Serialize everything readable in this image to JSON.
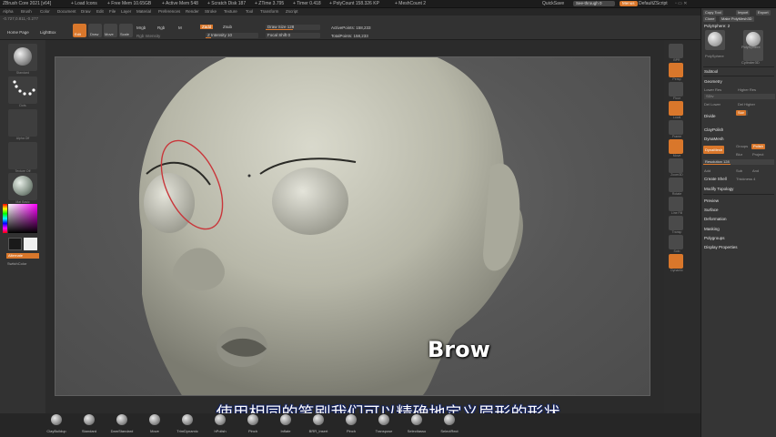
{
  "titlebar": {
    "app": "ZBrush Core 2021 [v64]",
    "load": "+ Load Icons",
    "free_mem": "+ Free Mem 10.65GB",
    "active_mem": "+ Active Mem 548",
    "scratch": "+ Scratch Disk 187",
    "ztime": "+ ZTime 3.795",
    "timer": "+ Timer 0.418",
    "polycount": "+ PolyCount 158.326 KP",
    "meshcount": "+ MeshCount 2",
    "quicksave": "QuickSave",
    "see_through": "See-through 0",
    "menus": "Menus",
    "default_script": "DefaultZScript"
  },
  "menubar": [
    "Alpha",
    "Brush",
    "Color",
    "Document",
    "Draw",
    "Edit",
    "File",
    "Layer",
    "Material",
    "Preferences",
    "Render",
    "Stroke",
    "Texture",
    "Tool",
    "Transform",
    "Zscript"
  ],
  "coords": "-0.727,0.811,-0.277",
  "toolbar": {
    "home_page": "Home Page",
    "lightbox": "LightBox",
    "edit": "Edit",
    "draw": "Draw",
    "move": "Move",
    "scale": "Scale",
    "rotate": "Rotate",
    "mrgb": "Mrgb",
    "rgb": "Rgb",
    "m": "M",
    "rgb_intensity": "Rgb Intensity",
    "zadd": "Zadd",
    "zsub": "Zsub",
    "z_intensity": "Z Intensity 10",
    "draw_size": "Draw Size 128",
    "focal_shift": "Focal Shift 0",
    "active_points": "ActivePoints: 158,233",
    "total_points": "TotalPoints: 158,233"
  },
  "progress": {
    "z_intensity": 0.1,
    "draw_size": 0.5
  },
  "left_shelf": [
    {
      "label": "Standard",
      "kind": "sphere"
    },
    {
      "label": "Dots",
      "kind": "dots"
    },
    {
      "label": "Alpha Off",
      "kind": "empty"
    },
    {
      "label": "Texture Off",
      "kind": "empty"
    },
    {
      "label": "Mat Basic",
      "kind": "matcap"
    }
  ],
  "color": {
    "alternate": "Alternate",
    "main": "#1a1a1a",
    "secondary": "#f0f0f0"
  },
  "half_label": "SwitchColor",
  "canvas_caption": "Brow",
  "subtitle": "使用相同的笔刷我们可以精确地定义眉形的形状",
  "bottom_brushes": [
    "ClayBuildup",
    "Standard",
    "DamStandard",
    "Move",
    "TrimDynamic",
    "hPolish",
    "Pinch",
    "Inflate",
    "BRR_Insert",
    "Pinch",
    "Transpose",
    "Selectlasso",
    "SelectRect"
  ],
  "right_shelf": [
    "BPR",
    "Persp",
    "Floor",
    "Local",
    "Frame",
    "Move",
    "Zoom3D",
    "Rotate",
    "Line Fill",
    "Transp",
    "Solo",
    "Dynamic"
  ],
  "tray": {
    "copy_label": "Copy Tool",
    "paste_label": "Paste",
    "import": "Import",
    "export": "Export",
    "clone": "Clone",
    "make_polymesh": "Make PolyMesh3D",
    "polysphere": "PolySphere: 2",
    "tools": [
      "PolySphere",
      "PolySphere",
      "Cylinder3D"
    ],
    "subtool": "Subtool",
    "geometry": "Geometry",
    "lower_res": "Lower Res",
    "higher_res": "Higher Res",
    "sdiv": "SDiv",
    "del_lower": "Del Lower",
    "del_higher": "Del Higher",
    "divide": "Divide",
    "smt": "Smt",
    "suv": "Suv",
    "claypolish": "ClayPolish",
    "dynamesh_header": "DynaMesh",
    "dynamesh": "DynaMesh",
    "groups": "Groups",
    "polish": "Polish",
    "blur": "Blur",
    "project": "Project",
    "resolution": "Resolution 128",
    "add": "Add",
    "sub": "Sub",
    "and": "And",
    "create_shell": "Create Shell",
    "thickness": "Thickness 4",
    "modify_topology": "Modify Topology",
    "preview": "Preview",
    "surface": "Surface",
    "deformation": "Deformation",
    "masking": "Masking",
    "polygroups": "Polygroups",
    "display_properties": "Display Properties"
  },
  "accent": "#d9772b"
}
